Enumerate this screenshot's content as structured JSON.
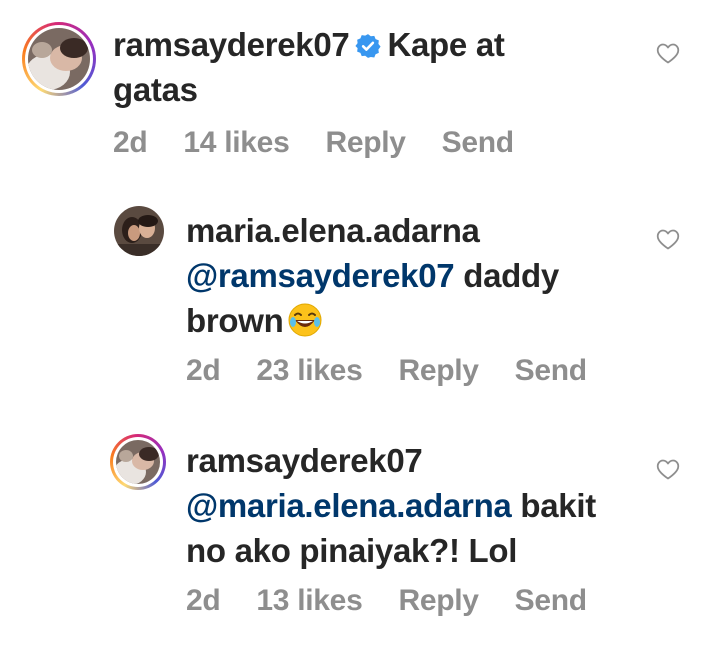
{
  "comments": [
    {
      "username": "ramsayderek07",
      "verified": true,
      "mention": "",
      "text_line1": "Kape at",
      "text_line2": "gatas",
      "time": "2d",
      "likes": "14 likes",
      "reply": "Reply",
      "send": "Send",
      "has_story_ring": true
    },
    {
      "username": "maria.elena.adarna",
      "verified": false,
      "mention": "@ramsayderek07",
      "text_after_mention": "daddy",
      "text_line3": "brown",
      "emoji": "face-with-tears-of-joy",
      "time": "2d",
      "likes": "23 likes",
      "reply": "Reply",
      "send": "Send",
      "has_story_ring": false
    },
    {
      "username": "ramsayderek07",
      "verified": false,
      "mention": "@maria.elena.adarna",
      "text_after_mention": "bakit",
      "text_line3": "no ako pinaiyak?! Lol",
      "time": "2d",
      "likes": "13 likes",
      "reply": "Reply",
      "send": "Send",
      "has_story_ring": true
    }
  ],
  "icons": {
    "like": "heart-outline-icon",
    "verified": "verified-badge-icon",
    "emoji": "laughing-emoji-icon"
  },
  "colors": {
    "text": "#262626",
    "muted": "#8e8e8e",
    "mention": "#00376b",
    "verified": "#3897f0"
  }
}
